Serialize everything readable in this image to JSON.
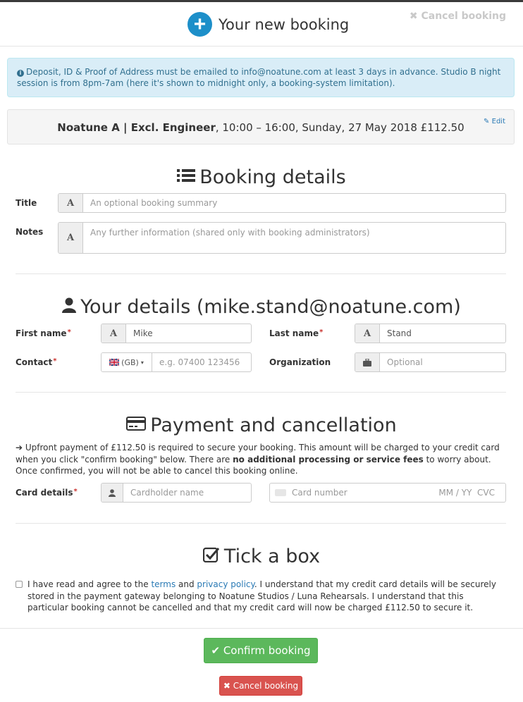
{
  "header": {
    "title": "Your new booking",
    "cancel_top": "✖ Cancel booking"
  },
  "info": {
    "icon": "info-circle-icon",
    "text": "Deposit, ID & Proof of Address must be emailed to info@noatune.com at least 3 days in advance. Studio B night session is from 8pm-7am (here it's shown to midnight only, a booking-system limitation)."
  },
  "summary": {
    "room": "Noatune A | Excl. Engineer",
    "details": ", 10:00 – 16:00, Sunday, 27 May 2018 £112.50",
    "edit": "Edit"
  },
  "booking_details": {
    "heading": "Booking details",
    "title_label": "Title",
    "title_placeholder": "An optional booking summary",
    "notes_label": "Notes",
    "notes_placeholder": "Any further information (shared only with booking administrators)"
  },
  "your_details": {
    "heading": "Your details (mike.stand@noatune.com)",
    "first_name_label": "First name",
    "first_name_value": "Mike",
    "last_name_label": "Last name",
    "last_name_value": "Stand",
    "contact_label": "Contact",
    "country_code": "(GB)",
    "phone_placeholder": "e.g. 07400 123456",
    "organization_label": "Organization",
    "organization_placeholder": "Optional",
    "required_mark": "*"
  },
  "payment": {
    "heading": "Payment and cancellation",
    "text_pre": "Upfront payment of £112.50 is required to secure your booking. This amount will be charged to your credit card when you click \"confirm booking\" below. There are ",
    "text_bold": "no additional processing or service fees",
    "text_post": " to worry about. Once confirmed, you will not be able to cancel this booking online.",
    "card_label": "Card details",
    "cardholder_placeholder": "Cardholder name",
    "card_number_placeholder": "Card number",
    "card_expiry_placeholder": "MM / YY  CVC"
  },
  "tick": {
    "heading": "Tick a box",
    "pre": "I have read and agree to the ",
    "terms": "terms",
    "and": " and ",
    "privacy": "privacy policy",
    "post": ".  I understand that my credit card details will be securely stored in the payment gateway belonging to Noatune Studios / Luna Rehearsals.  I understand that this particular booking cannot be cancelled and that my credit card will now be charged £112.50 to secure it."
  },
  "buttons": {
    "confirm": "✔ Confirm booking",
    "cancel": "✖ Cancel booking"
  },
  "colors": {
    "accent": "#1d8fc9",
    "confirm": "#5cb85c",
    "danger": "#d9534f",
    "info_bg": "#d9edf7",
    "info_text": "#31708f"
  }
}
